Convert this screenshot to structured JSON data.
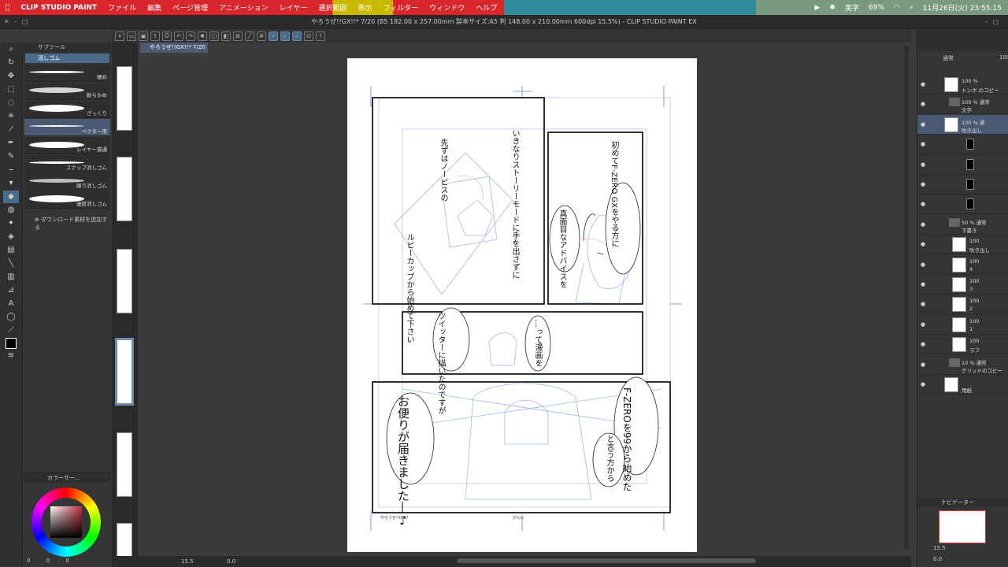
{
  "menubar": {
    "app": "CLIP STUDIO PAINT",
    "items": [
      "ファイル",
      "編集",
      "ページ管理",
      "アニメーション",
      "レイヤー",
      "選択範囲",
      "表示",
      "フィルター",
      "ウィンドウ",
      "ヘルプ"
    ],
    "input_lang": "英字",
    "battery": "69%",
    "datetime": "11月26日(火) 23:55:15"
  },
  "titlebar": {
    "text": "やろうぜ!!GX!!* 7/20 (B5 182.00 x 257.00mm 製本サイズ:A5 判 148.00 x 210.00mm 600dpi 15.5%) - CLIP STUDIO PAINT EX"
  },
  "canvas_tab": "やろうぜ!!GX!!* 7/20",
  "subtool": {
    "header": "サブツール",
    "group": "消しゴム",
    "brushes": [
      "硬め",
      "軟らかめ",
      "ざっくり",
      "ベクター用",
      "レイヤー貫通",
      "スナップ消しゴム",
      "練り消しゴム",
      "速度消しゴム"
    ],
    "add_material": "ダウンロード素材を追加する"
  },
  "color": {
    "header": "カラーサー...",
    "values": "0 0 0",
    "main": "#000000",
    "sub": "#ffffff"
  },
  "status": {
    "zoom": "15.5",
    "rotation": "0.0"
  },
  "manga": {
    "panel1_a": "いきなりストーリーモードに手を出さずに",
    "panel1_b": "先ずはノービスの",
    "panel1_c": "ルビーカップから始めて下さい",
    "panel2_a": "初めてF-ZERO GXをやる方に",
    "panel2_b": "真面目なアドバイスを",
    "panel3_a": "ツイッターに描いたのですが",
    "panel3_b": "…って漫画を",
    "panel4_a": "お便りが届きました―♪",
    "panel4_b": "F-ZEROを99から始めた",
    "panel4_c": "と言う方から",
    "footer_left": "やろうぜ!!GX!!",
    "footer_right": "がんに"
  },
  "layers": {
    "blend": "通常",
    "opacity": "100",
    "items": [
      {
        "pct": "100 %",
        "name": "トンボ のコピー"
      },
      {
        "pct": "100 % 通常",
        "name": "文字"
      },
      {
        "pct": "100 % 通",
        "name": "吹き出し"
      },
      {
        "pct": "",
        "name": ""
      },
      {
        "pct": "",
        "name": ""
      },
      {
        "pct": "",
        "name": ""
      },
      {
        "pct": "",
        "name": ""
      },
      {
        "pct": "50 % 通常",
        "name": "下書き"
      },
      {
        "pct": "100",
        "name": "吹き出し"
      },
      {
        "pct": "100",
        "name": "4"
      },
      {
        "pct": "100",
        "name": "3"
      },
      {
        "pct": "100",
        "name": "2"
      },
      {
        "pct": "100",
        "name": "1"
      },
      {
        "pct": "100",
        "name": "ラフ"
      },
      {
        "pct": "10 % 通常",
        "name": "グリッドのコピー"
      },
      {
        "pct": "",
        "name": "用紙"
      }
    ]
  },
  "navigator": {
    "header": "ナビゲーター",
    "zoom": "15.5",
    "rotation": "0.0"
  }
}
